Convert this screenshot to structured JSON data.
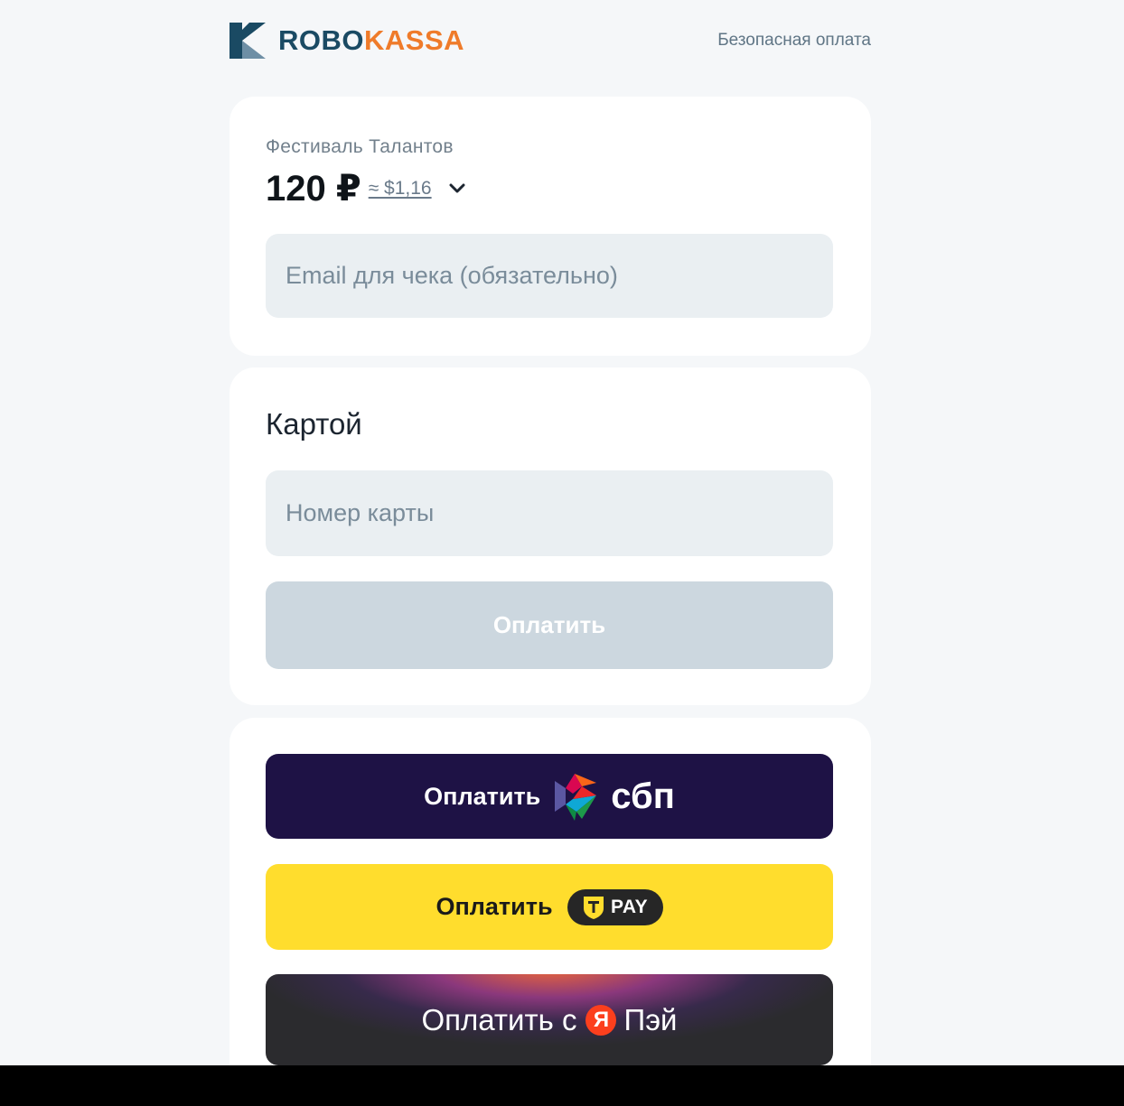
{
  "header": {
    "logo_part1": "ROBO",
    "logo_part2": "KASSA",
    "secure_label": "Безопасная оплата"
  },
  "order": {
    "merchant": "Фестиваль Талантов",
    "amount": "120 ₽",
    "approx_usd": "≈ $1,16"
  },
  "email": {
    "placeholder": "Email для чека (обязательно)",
    "value": ""
  },
  "card_section": {
    "title": "Картой",
    "card_number_placeholder": "Номер карты",
    "pay_label": "Оплатить"
  },
  "alt_payments": {
    "sbp": {
      "label": "Оплатить",
      "brand": "сбп"
    },
    "tpay": {
      "label": "Оплатить",
      "brand": "PAY",
      "shield_letter": "T"
    },
    "yapay": {
      "label_before": "Оплатить с",
      "logo_letter": "Я",
      "label_after": "Пэй"
    }
  },
  "colors": {
    "robo": "#1a4a63",
    "kassa": "#ef7b2a",
    "sbp_bg": "#1e1245",
    "tpay_bg": "#ffdd2d",
    "yapay_bg": "#2b2b2e",
    "pay_disabled": "#ccd7df"
  },
  "icons": [
    "robokassa-logo-icon",
    "chevron-down-icon",
    "sbp-logo-icon",
    "tpay-shield-icon",
    "yandex-logo-icon"
  ]
}
